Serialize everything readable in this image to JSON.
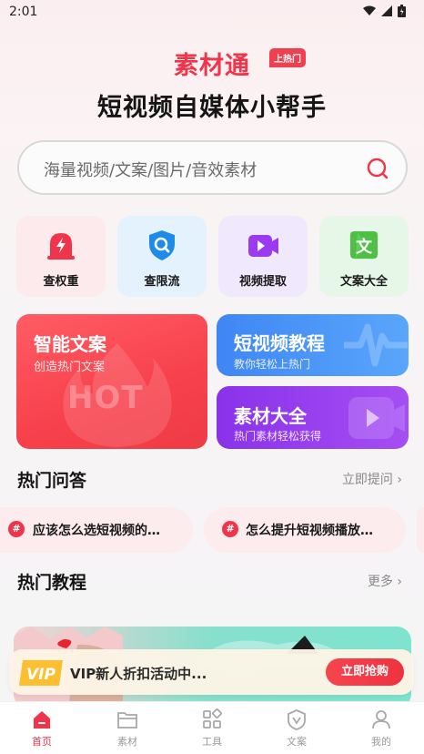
{
  "status_bar": {
    "time": "2:01"
  },
  "brand": {
    "name": "素材通",
    "badge": "上热门"
  },
  "slogan": "短视频自媒体小帮手",
  "search": {
    "placeholder": "海量视频/文案/图片/音效素材"
  },
  "tools": [
    {
      "label": "查权重",
      "icon": "alarm-icon",
      "color": "#f0344a",
      "bg": "#fdeaec"
    },
    {
      "label": "查限流",
      "icon": "shield-search-icon",
      "color": "#1f8be8",
      "bg": "#e3f2fc"
    },
    {
      "label": "视频提取",
      "icon": "video-icon",
      "color": "#9b3af0",
      "bg": "#f0e8fc"
    },
    {
      "label": "文案大全",
      "icon": "text-icon",
      "color": "#4fc046",
      "bg": "#e6f7e8"
    }
  ],
  "cards": {
    "hot": {
      "title": "智能文案",
      "subtitle": "创造热门文案",
      "watermark": "HOT"
    },
    "video": {
      "title": "短视频教程",
      "subtitle": "教你轻松上热门"
    },
    "material": {
      "title": "素材大全",
      "subtitle": "热门素材轻松获得"
    }
  },
  "qa": {
    "title": "热门问答",
    "more": "立即提问 ›",
    "items": [
      {
        "hash": "#",
        "text": "应该怎么选短视频的…"
      },
      {
        "hash": "#",
        "text": "怎么提升短视频播放…"
      }
    ]
  },
  "tutorials": {
    "title": "热门教程",
    "more": "更多 ›"
  },
  "vip": {
    "logo": "VIP",
    "text": "VIP新人折扣活动中...",
    "button": "立即抢购"
  },
  "tabs": [
    {
      "label": "首页",
      "icon": "home-icon",
      "active": true
    },
    {
      "label": "素材",
      "icon": "folder-icon",
      "active": false
    },
    {
      "label": "工具",
      "icon": "grid-icon",
      "active": false
    },
    {
      "label": "文案",
      "icon": "shield-v-icon",
      "active": false
    },
    {
      "label": "我的",
      "icon": "user-icon",
      "active": false
    }
  ],
  "colors": {
    "brand": "#f0344a",
    "accent_blue": "#3f86f4",
    "accent_purple": "#8a32ea"
  }
}
